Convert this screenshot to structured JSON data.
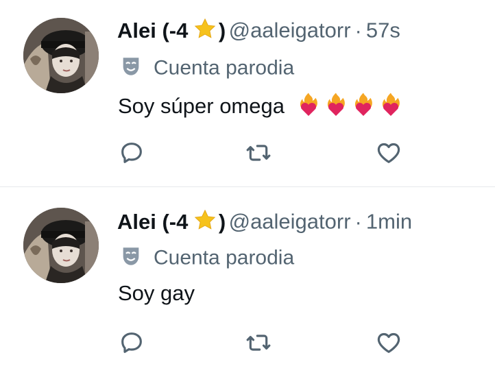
{
  "tweets": [
    {
      "name": "Alei (-4",
      "name_close": ")",
      "handle": "@aaleigatorr",
      "separator": "·",
      "time": "57s",
      "account_label": "Cuenta parodia",
      "text": "Soy súper omega",
      "emoji_count": 4,
      "icons": {
        "reply": "reply-icon",
        "retweet": "retweet-icon",
        "like": "heart-icon"
      }
    },
    {
      "name": "Alei (-4",
      "name_close": ")",
      "handle": "@aaleigatorr",
      "separator": "·",
      "time": "1min",
      "account_label": "Cuenta parodia",
      "text": "Soy gay",
      "emoji_count": 0,
      "icons": {
        "reply": "reply-icon",
        "retweet": "retweet-icon",
        "like": "heart-icon"
      }
    }
  ],
  "colors": {
    "text_primary": "#0f1419",
    "text_secondary": "#536471",
    "divider": "#e6e9ec",
    "icon": "#536471",
    "star": "#f6c21c",
    "parody_mask": "#8a98a6"
  }
}
